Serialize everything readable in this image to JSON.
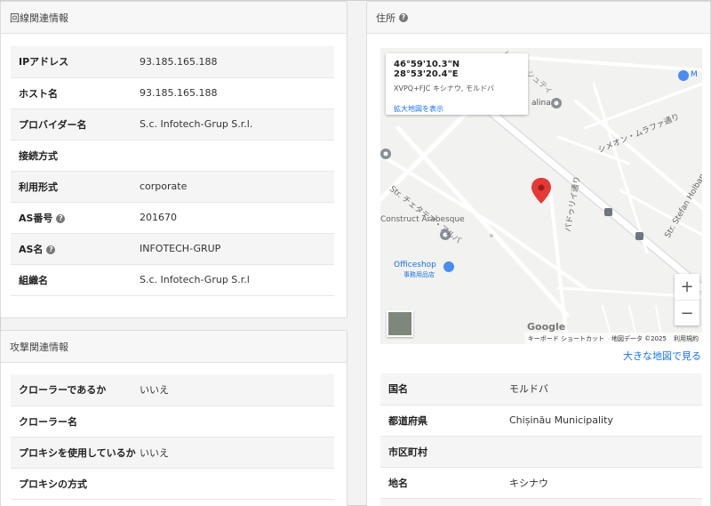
{
  "connection": {
    "title": "回線関連情報",
    "rows": [
      {
        "label": "IPアドレス",
        "value": "93.185.165.188",
        "help": false
      },
      {
        "label": "ホスト名",
        "value": "93.185.165.188",
        "help": false
      },
      {
        "label": "プロバイダー名",
        "value": "S.c. Infotech-Grup S.r.l.",
        "help": false
      },
      {
        "label": "接続方式",
        "value": "",
        "help": false
      },
      {
        "label": "利用形式",
        "value": "corporate",
        "help": false
      },
      {
        "label": "AS番号",
        "value": "201670",
        "help": true
      },
      {
        "label": "AS名",
        "value": "INFOTECH-GRUP",
        "help": true
      },
      {
        "label": "組織名",
        "value": "S.c. Infotech-Grup S.r.l",
        "help": false
      }
    ]
  },
  "attack": {
    "title": "攻撃関連情報",
    "rows": [
      {
        "label": "クローラーであるか",
        "value": "いいえ"
      },
      {
        "label": "クローラー名",
        "value": ""
      },
      {
        "label": "プロキシを使用しているか",
        "value": "いいえ"
      },
      {
        "label": "プロキシの方式",
        "value": ""
      }
    ]
  },
  "address": {
    "title": "住所",
    "map": {
      "coordinates": "46°59'10.3\"N 28°53'20.4\"E",
      "plus_code": "XVPQ+FJC キシナウ, モルドバ",
      "view_larger": "拡大地図を表示",
      "zoom_in": "+",
      "zoom_out": "−",
      "google": "Google",
      "shortcuts": "キーボード ショートカット",
      "map_data": "地図データ ©2025",
      "terms": "利用規約",
      "labels": {
        "street1": "Str. チェタテア・アルバ",
        "street2": "シメオン・ムラファ通り",
        "street3": "パドゥリイ通り",
        "street4": "Str. Stefan Holban",
        "poi1": "Construct Arabesque",
        "poi2": "Officeshop",
        "poi2_sub": "事務用品店",
        "poi3": "alina",
        "street5": "ムンチェシュティ",
        "poi4": "M"
      }
    },
    "larger_map": "大きな地図で見る",
    "rows": [
      {
        "label": "国名",
        "value": "モルドバ"
      },
      {
        "label": "都道府県",
        "value": "Chișinău Municipality"
      },
      {
        "label": "市区町村",
        "value": ""
      },
      {
        "label": "地名",
        "value": "キシナウ"
      },
      {
        "label": "",
        "value": ""
      }
    ]
  }
}
